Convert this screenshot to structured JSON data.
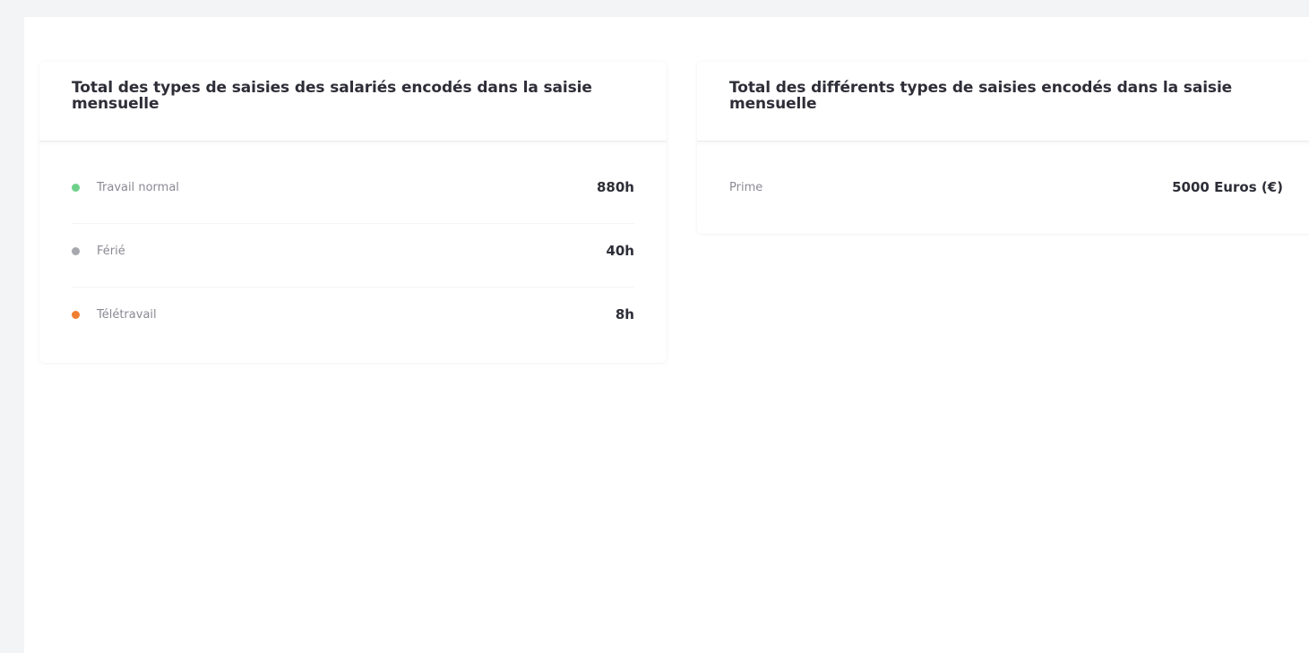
{
  "cards": [
    {
      "title": "Total des types de saisies des salariés encodés dans la saisie mensuelle",
      "items": [
        {
          "label": "Travail normal",
          "value": "880h",
          "dot_color": "#6fd08a"
        },
        {
          "label": "Férié",
          "value": "40h",
          "dot_color": "#a7a7ae"
        },
        {
          "label": "Télétravail",
          "value": "8h",
          "dot_color": "#ef7e32"
        }
      ]
    },
    {
      "title": "Total des différents types de saisies encodés dans la saisie mensuelle",
      "items": [
        {
          "label": "Prime",
          "value": "5000 Euros (€)"
        }
      ]
    }
  ]
}
